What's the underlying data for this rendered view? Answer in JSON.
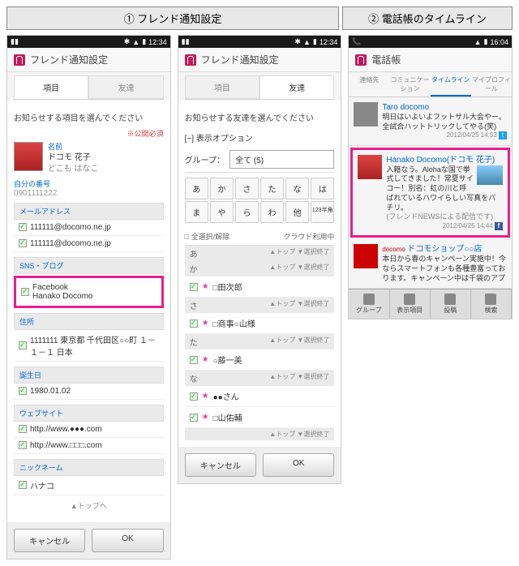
{
  "headers": {
    "h1": "① フレンド通知設定",
    "h2": "② 電話帳のタイムライン"
  },
  "status": {
    "time1": "12:34",
    "time2": "16:04"
  },
  "s1": {
    "title": "フレンド通知設定",
    "tabs": {
      "items": "項目",
      "friends": "友達"
    },
    "instruction": "お知らせする項目を選んでください",
    "required": "※公開必須",
    "profile": {
      "name_label": "名前",
      "name": "ドコモ 花子",
      "kana": "どこも はなこ",
      "my_number": "自分の番号",
      "phone": "0901111222"
    },
    "sections": {
      "mail": "メールアドレス",
      "mail_items": [
        "111111@docomo.ne.jp",
        "111111@docomo.ne.jp"
      ],
      "sns": "SNS・ブログ",
      "sns_items": [
        "Facebook",
        "Hanako Docomo"
      ],
      "address": "住所",
      "address_item": "1111111 東京都 千代田区○○町 １－１－１ 日本",
      "birthday": "誕生日",
      "birthday_item": "1980.01.02",
      "website": "ウェブサイト",
      "website_items": [
        "http://www.●●●.com",
        "http://www.□□□.com"
      ],
      "nickname": "ニックネーム",
      "nickname_item": "ハナコ"
    },
    "toplink": "▲トップへ",
    "btns": {
      "cancel": "キャンセル",
      "ok": "OK"
    }
  },
  "s2": {
    "title": "フレンド通知設定",
    "tabs": {
      "items": "項目",
      "friends": "友達"
    },
    "instruction": "お知らせする友達を選んでください",
    "opt_header": "[−] 表示オプション",
    "group_label": "グループ：",
    "group_value": "全て (5)",
    "kana": [
      "あ",
      "か",
      "さ",
      "た",
      "な",
      "は",
      "ま",
      "や",
      "ら",
      "わ",
      "他",
      "123半角"
    ],
    "select_all": "□ 全選択/解除",
    "cloud": "クラウド利用中",
    "rows": [
      {
        "k": "あ",
        "links": "▲トップ ▼選択終了"
      },
      {
        "k": "か",
        "name": "□田次郎",
        "links": "▲トップ ▼選択終了"
      },
      {
        "k": "さ",
        "name": "□商事○山様",
        "links": "▲トップ ▼選択終了"
      },
      {
        "k": "た",
        "name": "○藤一美",
        "links": "▲トップ ▼選択終了"
      },
      {
        "k": "な",
        "name": "●●さん",
        "links": "▲トップ ▼選択終了"
      },
      {
        "k": "",
        "name": "□山佑輔",
        "links": "▲トップ ▼選択終了"
      }
    ],
    "btns": {
      "cancel": "キャンセル",
      "ok": "OK"
    }
  },
  "s3": {
    "title": "電話帳",
    "tabs": [
      "連絡先",
      "コミュニケーション",
      "タイムライン",
      "マイプロフィール"
    ],
    "posts": [
      {
        "name": "Taro docomo",
        "text": "明日はいよいよフットサル大会やー。全試合ハットトリックしてやる(笑)",
        "date": "2012/04/25 14:53"
      },
      {
        "name": "Hanako Docomo(ドコモ 花子)",
        "text": "入籍なう。Alohaな国で挙式してきました！常夏サイコー！別名：虹の川と呼ばれているハワイらしい写真をパチリ。",
        "note": "(フレンドNEWSによる配信です)",
        "date": "2012/04/25 14:44"
      },
      {
        "name": "ドコモショップ○○店",
        "text": "本日から春のキャンペーン実施中！今ならスマートフォンも各種豊富っております。キャンペーン中は千袋のアプ",
        "prefix": "docomo"
      }
    ],
    "nav": [
      "グループ",
      "表示項目",
      "投稿",
      "検索"
    ]
  }
}
